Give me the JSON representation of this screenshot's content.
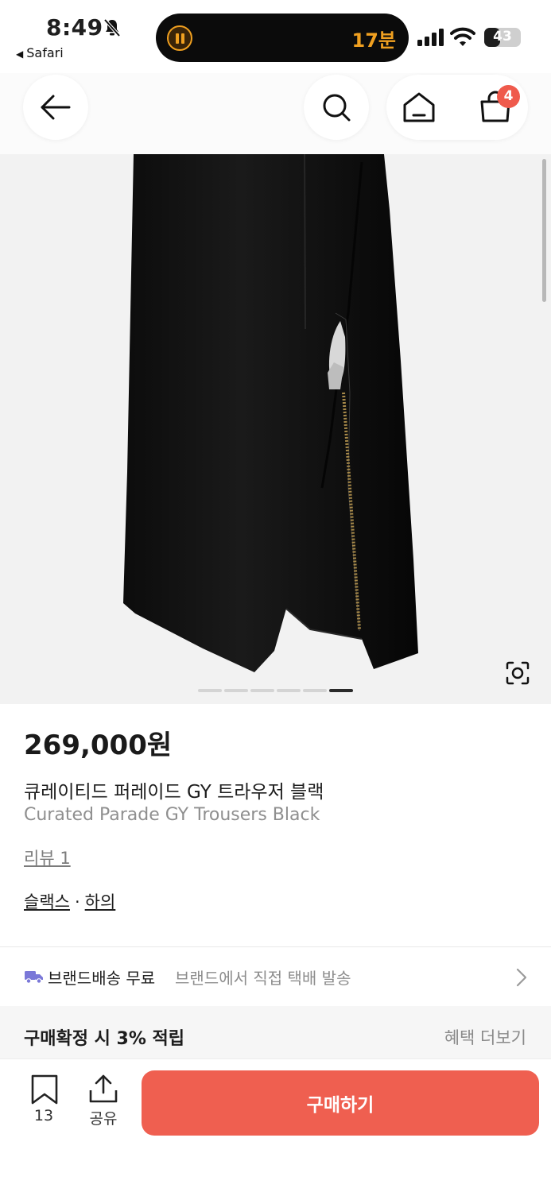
{
  "status_bar": {
    "time": "8:49",
    "back_app": "Safari",
    "timer": "17분",
    "battery": "43",
    "battery_level": 0.43
  },
  "nav": {
    "cart_count": "4"
  },
  "gallery": {
    "page_count": 6,
    "active_index": 5
  },
  "product": {
    "price": "269,000원",
    "name_ko": "큐레이티드 퍼레이드 GY 트라우저 블랙",
    "name_en": "Curated Parade GY Trousers Black",
    "review": "리뷰 1",
    "category_1": "슬랙스",
    "category_sep": "·",
    "category_2": "하의"
  },
  "shipping": {
    "strong": "브랜드배송 무료",
    "light": "브랜드에서 직접 택배 발송",
    "icon": "truck-icon",
    "icon_color": "#7a78d8"
  },
  "benefit": {
    "left": "구매확정 시 3% 적립",
    "right": "혜택 더보기"
  },
  "bottom_bar": {
    "bookmark_count": "13",
    "share_label": "공유",
    "buy_label": "구매하기",
    "buy_color": "#ef5f50"
  }
}
